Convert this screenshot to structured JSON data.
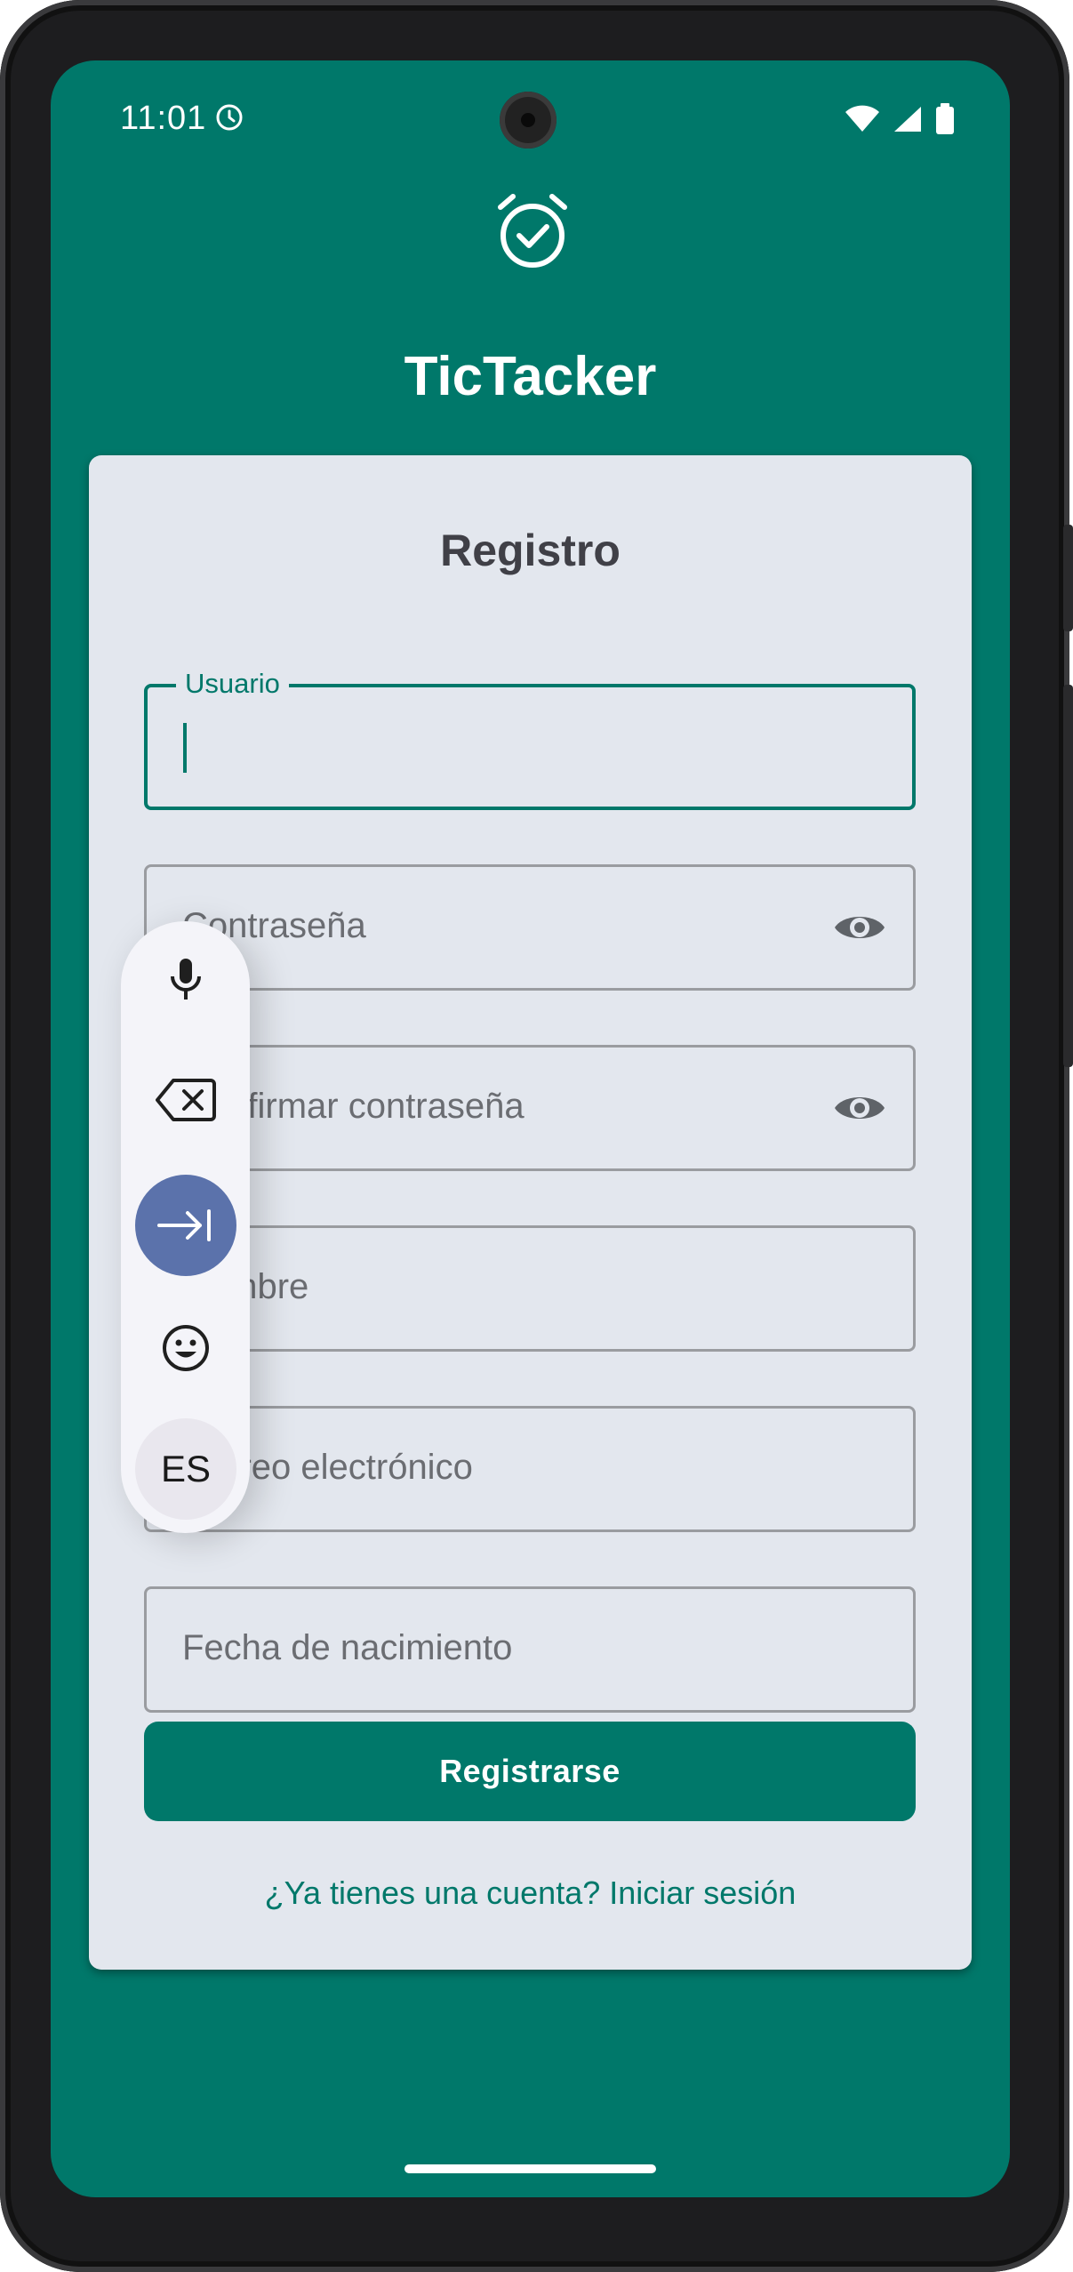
{
  "status_bar": {
    "time": "11:01",
    "icons": [
      "alarm-clock-icon",
      "wifi-icon",
      "signal-icon",
      "battery-icon"
    ]
  },
  "app": {
    "title": "TicTacker",
    "logo_icon": "alarm-check-icon"
  },
  "form": {
    "title": "Registro",
    "fields": [
      {
        "label": "Usuario",
        "value": "",
        "focused": true
      },
      {
        "placeholder": "Contraseña",
        "trailing_icon": "eye-icon"
      },
      {
        "placeholder": "Confirmar contraseña",
        "trailing_icon": "eye-icon"
      },
      {
        "placeholder": "Nombre"
      },
      {
        "placeholder": "Correo electrónico"
      },
      {
        "placeholder": "Fecha de nacimiento"
      }
    ],
    "submit_label": "Registrarse",
    "login_link": "¿Ya tienes una cuenta? Iniciar sesión"
  },
  "floating_toolbar": {
    "items": [
      "mic-icon",
      "backspace-icon",
      "tab-icon",
      "emoji-icon"
    ],
    "language": "ES"
  },
  "colors": {
    "primary": "#00786a",
    "card": "#e3e7ee",
    "toolbar_active": "#5b72ab"
  }
}
